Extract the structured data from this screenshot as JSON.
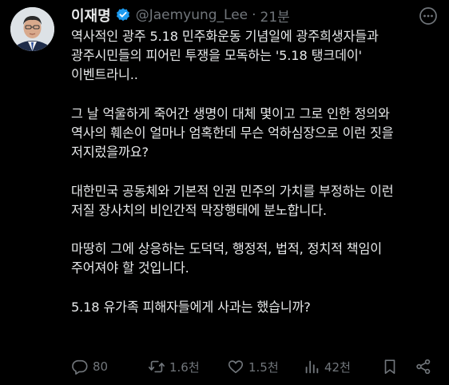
{
  "author": {
    "display_name": "이재명",
    "handle": "@Jaemyung_Lee",
    "separator": "·",
    "time": "21분"
  },
  "tweet": {
    "paragraphs": [
      [
        "역사적인 광주 5.18 민주화운동 기념일에 광주희생자들과",
        "광주시민들의 피어린 투쟁을 모독하는 '5.18 탱크데이'",
        "이벤트라니.."
      ],
      [
        "그 날 억울하게 죽어간 생명이 대체 몇이고 그로 인한 정의와",
        "역사의 훼손이 얼마나 엄혹한데 무슨 억하심장으로 이런 짓을",
        "저지렀을까요?"
      ],
      [
        "대한민국 공동체와 기본적 인권 민주의 가치를 부정하는 이런",
        "저질 장사치의 비인간적 막장행태에 분노합니다."
      ],
      [
        "마땅히 그에 상응하는 도덕덕, 행정적, 법적, 정치적 책임이",
        "주어져야 할 것입니다."
      ],
      [
        "5.18 유가족 피해자들에게 사과는 했습니까?"
      ]
    ]
  },
  "actions": {
    "replies": "80",
    "reposts": "1.6천",
    "likes": "1.5천",
    "views": "42천"
  },
  "icons": {
    "verified": "verified-badge-icon",
    "more": "more-options-icon",
    "reply": "reply-icon",
    "repost": "repost-icon",
    "like": "heart-icon",
    "views": "views-icon",
    "bookmark": "bookmark-icon",
    "share": "share-icon"
  },
  "colors": {
    "background": "#000000",
    "text": "#e7e9ea",
    "secondary": "#71767b",
    "verified": "#1d9bf0"
  }
}
